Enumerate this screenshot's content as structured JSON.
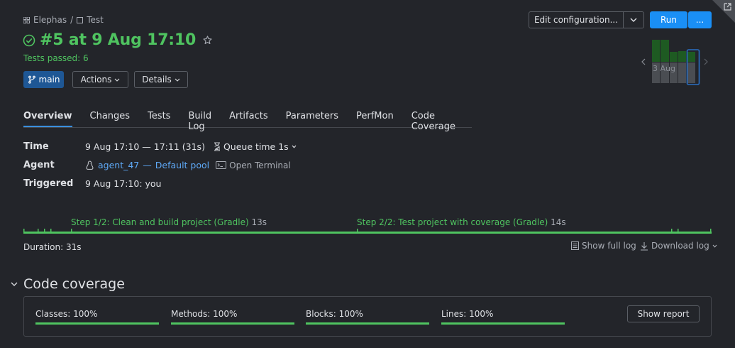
{
  "breadcrumb": {
    "project": "Elephas",
    "separator": "/",
    "build_config": "Test"
  },
  "build": {
    "title": "#5 at 9 Aug 17:10",
    "tests_passed": "Tests passed: 6",
    "branch": "main",
    "actions_label": "Actions",
    "details_label": "Details"
  },
  "toolbar": {
    "edit_label": "Edit configuration...",
    "run_label": "Run",
    "more_label": "..."
  },
  "history": {
    "date_label": "3 Aug"
  },
  "tabs": [
    {
      "label": "Overview",
      "active": true
    },
    {
      "label": "Changes"
    },
    {
      "label": "Tests"
    },
    {
      "label": "Build Log"
    },
    {
      "label": "Artifacts"
    },
    {
      "label": "Parameters"
    },
    {
      "label": "PerfMon"
    },
    {
      "label": "Code Coverage"
    }
  ],
  "info": {
    "time_label": "Time",
    "time_value": "9 Aug 17:10 — 17:11 (31s)",
    "queue_time": "Queue time 1s",
    "agent_label": "Agent",
    "agent_name": "agent_47",
    "agent_sep": "—",
    "agent_pool": "Default pool",
    "open_terminal": "Open Terminal",
    "triggered_label": "Triggered",
    "triggered_value": "9 Aug 17:10: you"
  },
  "steps": [
    {
      "label": "Step 1/2: Clean and build project (Gradle)",
      "duration": "13s"
    },
    {
      "label": "Step 2/2: Test project with coverage (Gradle)",
      "duration": "14s"
    }
  ],
  "log": {
    "duration": "Duration: 31s",
    "show_full_log": "Show full log",
    "download_log": "Download log"
  },
  "coverage": {
    "title": "Code coverage",
    "metrics": [
      {
        "label": "Classes: 100%",
        "percent": 100
      },
      {
        "label": "Methods: 100%",
        "percent": 100
      },
      {
        "label": "Blocks: 100%",
        "percent": 100
      },
      {
        "label": "Lines: 100%",
        "percent": 100
      }
    ],
    "show_report": "Show report"
  },
  "colors": {
    "success": "#4fc460",
    "accent": "#1a8ff5",
    "link": "#5ea8f5"
  }
}
